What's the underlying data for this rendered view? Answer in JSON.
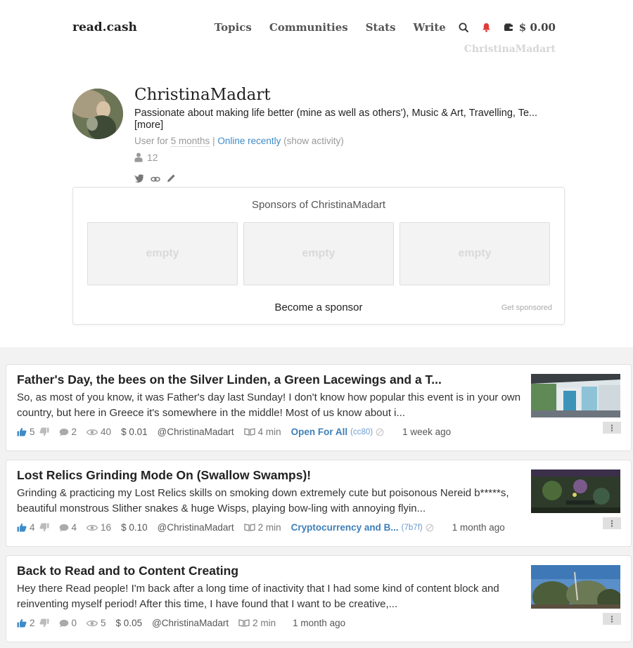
{
  "header": {
    "logo": "read.cash",
    "nav": [
      "Topics",
      "Communities",
      "Stats",
      "Write"
    ],
    "balance": "$ 0.00",
    "username": "ChristinaMadart"
  },
  "profile": {
    "name": "ChristinaMadart",
    "bio": "Passionate about making life better (mine as well as others'), Music & Art, Travelling, Te...",
    "more": "[more]",
    "user_for_prefix": "User for",
    "user_for_value": "5 months",
    "separator": "|",
    "online": "Online recently",
    "show_activity": "(show activity)",
    "followers": "12"
  },
  "sponsors": {
    "title": "Sponsors of ChristinaMadart",
    "slots": [
      "empty",
      "empty",
      "empty"
    ],
    "become": "Become a sponsor",
    "get_sponsored": "Get sponsored"
  },
  "articles": [
    {
      "title": "Father's Day, the bees on the Silver Linden, a Green Lacewings and a T...",
      "excerpt": "So, as most of you know, it was Father's day last Sunday! I don't know how popular this event is in your own country, but here in Greece it's somewhere in the middle! Most of us know about i...",
      "likes": "5",
      "comments": "2",
      "views": "40",
      "earned": "$ 0.01",
      "author": "@ChristinaMadart",
      "read_time": "4 min",
      "community": "Open For All",
      "community_code": "(cc80)",
      "ago": "1 week ago"
    },
    {
      "title": "Lost Relics Grinding Mode On (Swallow Swamps)!",
      "excerpt": "Grinding & practicing my Lost Relics skills on smoking down extremely cute but poisonous Nereid b*****s, beautiful monstrous Slither snakes & huge Wisps, playing bow-ling with annoying flyin...",
      "likes": "4",
      "comments": "4",
      "views": "16",
      "earned": "$ 0.10",
      "author": "@ChristinaMadart",
      "read_time": "2 min",
      "community": "Cryptocurrency and B...",
      "community_code": "(7b7f)",
      "ago": "1 month ago"
    },
    {
      "title": "Back to Read and to Content Creating",
      "excerpt": "Hey there Read people! I'm back after a long time of inactivity that I had some kind of content block and reinventing myself period! After this time, I have found that I want to be creative,...",
      "likes": "2",
      "comments": "0",
      "views": "5",
      "earned": "$ 0.05",
      "author": "@ChristinaMadart",
      "read_time": "2 min",
      "ago": "1 month ago"
    }
  ],
  "colors": {
    "accent_blue": "#3f8bc7",
    "bell_red": "#e03b3b",
    "feed_bg": "#f2f2f2"
  }
}
